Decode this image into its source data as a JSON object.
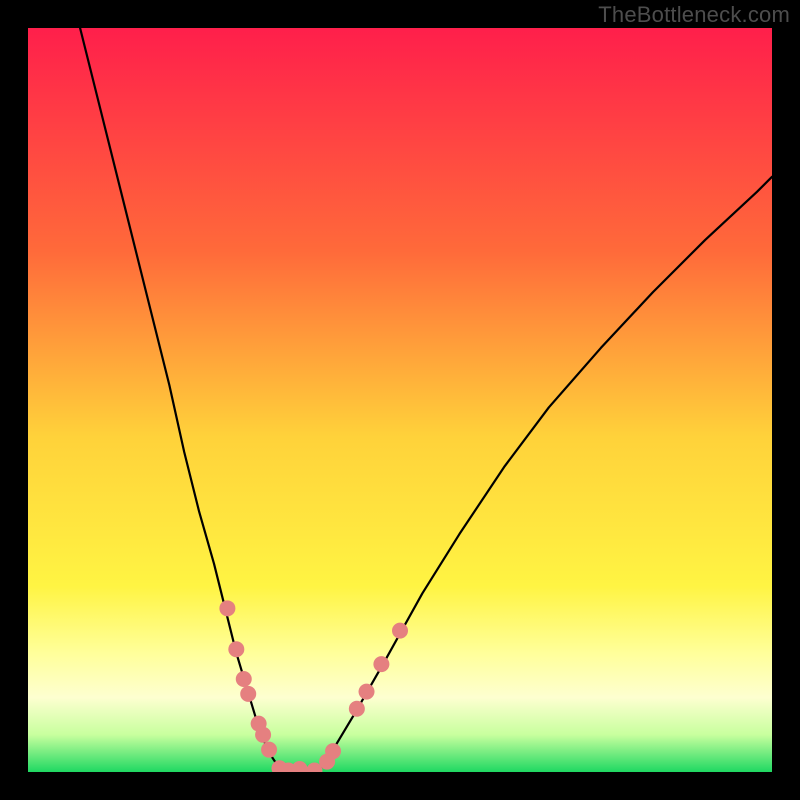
{
  "watermark": "TheBottleneck.com",
  "chart_data": {
    "type": "line",
    "title": "",
    "xlabel": "",
    "ylabel": "",
    "xlim": [
      0,
      100
    ],
    "ylim": [
      0,
      100
    ],
    "grid": false,
    "background_gradient": {
      "stops": [
        {
          "offset": 0,
          "color": "#ff1f4b"
        },
        {
          "offset": 30,
          "color": "#ff6a3a"
        },
        {
          "offset": 55,
          "color": "#ffd23a"
        },
        {
          "offset": 75,
          "color": "#fff443"
        },
        {
          "offset": 84,
          "color": "#ffff9a"
        },
        {
          "offset": 90,
          "color": "#fdffd0"
        },
        {
          "offset": 95,
          "color": "#c8ff9e"
        },
        {
          "offset": 100,
          "color": "#1fd862"
        }
      ]
    },
    "series": [
      {
        "name": "left-curve",
        "stroke": "#000000",
        "x": [
          7,
          10,
          13,
          16,
          19,
          21,
          23,
          25,
          26.5,
          28,
          29.5,
          30.7,
          31.8,
          32.8,
          33.6,
          34.3
        ],
        "y": [
          100,
          88,
          76,
          64,
          52,
          43,
          35,
          28,
          22,
          16,
          11,
          7,
          4,
          2,
          0.8,
          0
        ]
      },
      {
        "name": "valley",
        "stroke": "#000000",
        "x": [
          34.3,
          35,
          36,
          37,
          38,
          39
        ],
        "y": [
          0,
          0,
          0.3,
          0.5,
          0.2,
          0
        ]
      },
      {
        "name": "right-curve",
        "stroke": "#000000",
        "x": [
          39,
          41,
          44,
          48,
          53,
          58,
          64,
          70,
          77,
          84,
          91,
          98,
          100
        ],
        "y": [
          0,
          3,
          8,
          15,
          24,
          32,
          41,
          49,
          57,
          64.5,
          71.5,
          78,
          80
        ]
      }
    ],
    "markers": [
      {
        "series": "left-curve",
        "x": 26.8,
        "y": 22.0,
        "r": 8,
        "color": "#e58080"
      },
      {
        "series": "left-curve",
        "x": 28.0,
        "y": 16.5,
        "r": 8,
        "color": "#e58080"
      },
      {
        "series": "left-curve",
        "x": 29.0,
        "y": 12.5,
        "r": 8,
        "color": "#e58080"
      },
      {
        "series": "left-curve",
        "x": 29.6,
        "y": 10.5,
        "r": 8,
        "color": "#e58080"
      },
      {
        "series": "left-curve",
        "x": 31.0,
        "y": 6.5,
        "r": 8,
        "color": "#e58080"
      },
      {
        "series": "left-curve",
        "x": 31.6,
        "y": 5.0,
        "r": 8,
        "color": "#e58080"
      },
      {
        "series": "left-curve",
        "x": 32.4,
        "y": 3.0,
        "r": 8,
        "color": "#e58080"
      },
      {
        "series": "valley",
        "x": 33.8,
        "y": 0.5,
        "r": 8,
        "color": "#e58080"
      },
      {
        "series": "valley",
        "x": 35.0,
        "y": 0.2,
        "r": 8,
        "color": "#e58080"
      },
      {
        "series": "valley",
        "x": 36.5,
        "y": 0.4,
        "r": 8,
        "color": "#e58080"
      },
      {
        "series": "valley",
        "x": 38.5,
        "y": 0.2,
        "r": 8,
        "color": "#e58080"
      },
      {
        "series": "right-curve",
        "x": 40.2,
        "y": 1.4,
        "r": 8,
        "color": "#e58080"
      },
      {
        "series": "right-curve",
        "x": 41.0,
        "y": 2.8,
        "r": 8,
        "color": "#e58080"
      },
      {
        "series": "right-curve",
        "x": 44.2,
        "y": 8.5,
        "r": 8,
        "color": "#e58080"
      },
      {
        "series": "right-curve",
        "x": 45.5,
        "y": 10.8,
        "r": 8,
        "color": "#e58080"
      },
      {
        "series": "right-curve",
        "x": 47.5,
        "y": 14.5,
        "r": 8,
        "color": "#e58080"
      },
      {
        "series": "right-curve",
        "x": 50.0,
        "y": 19.0,
        "r": 8,
        "color": "#e58080"
      }
    ]
  }
}
